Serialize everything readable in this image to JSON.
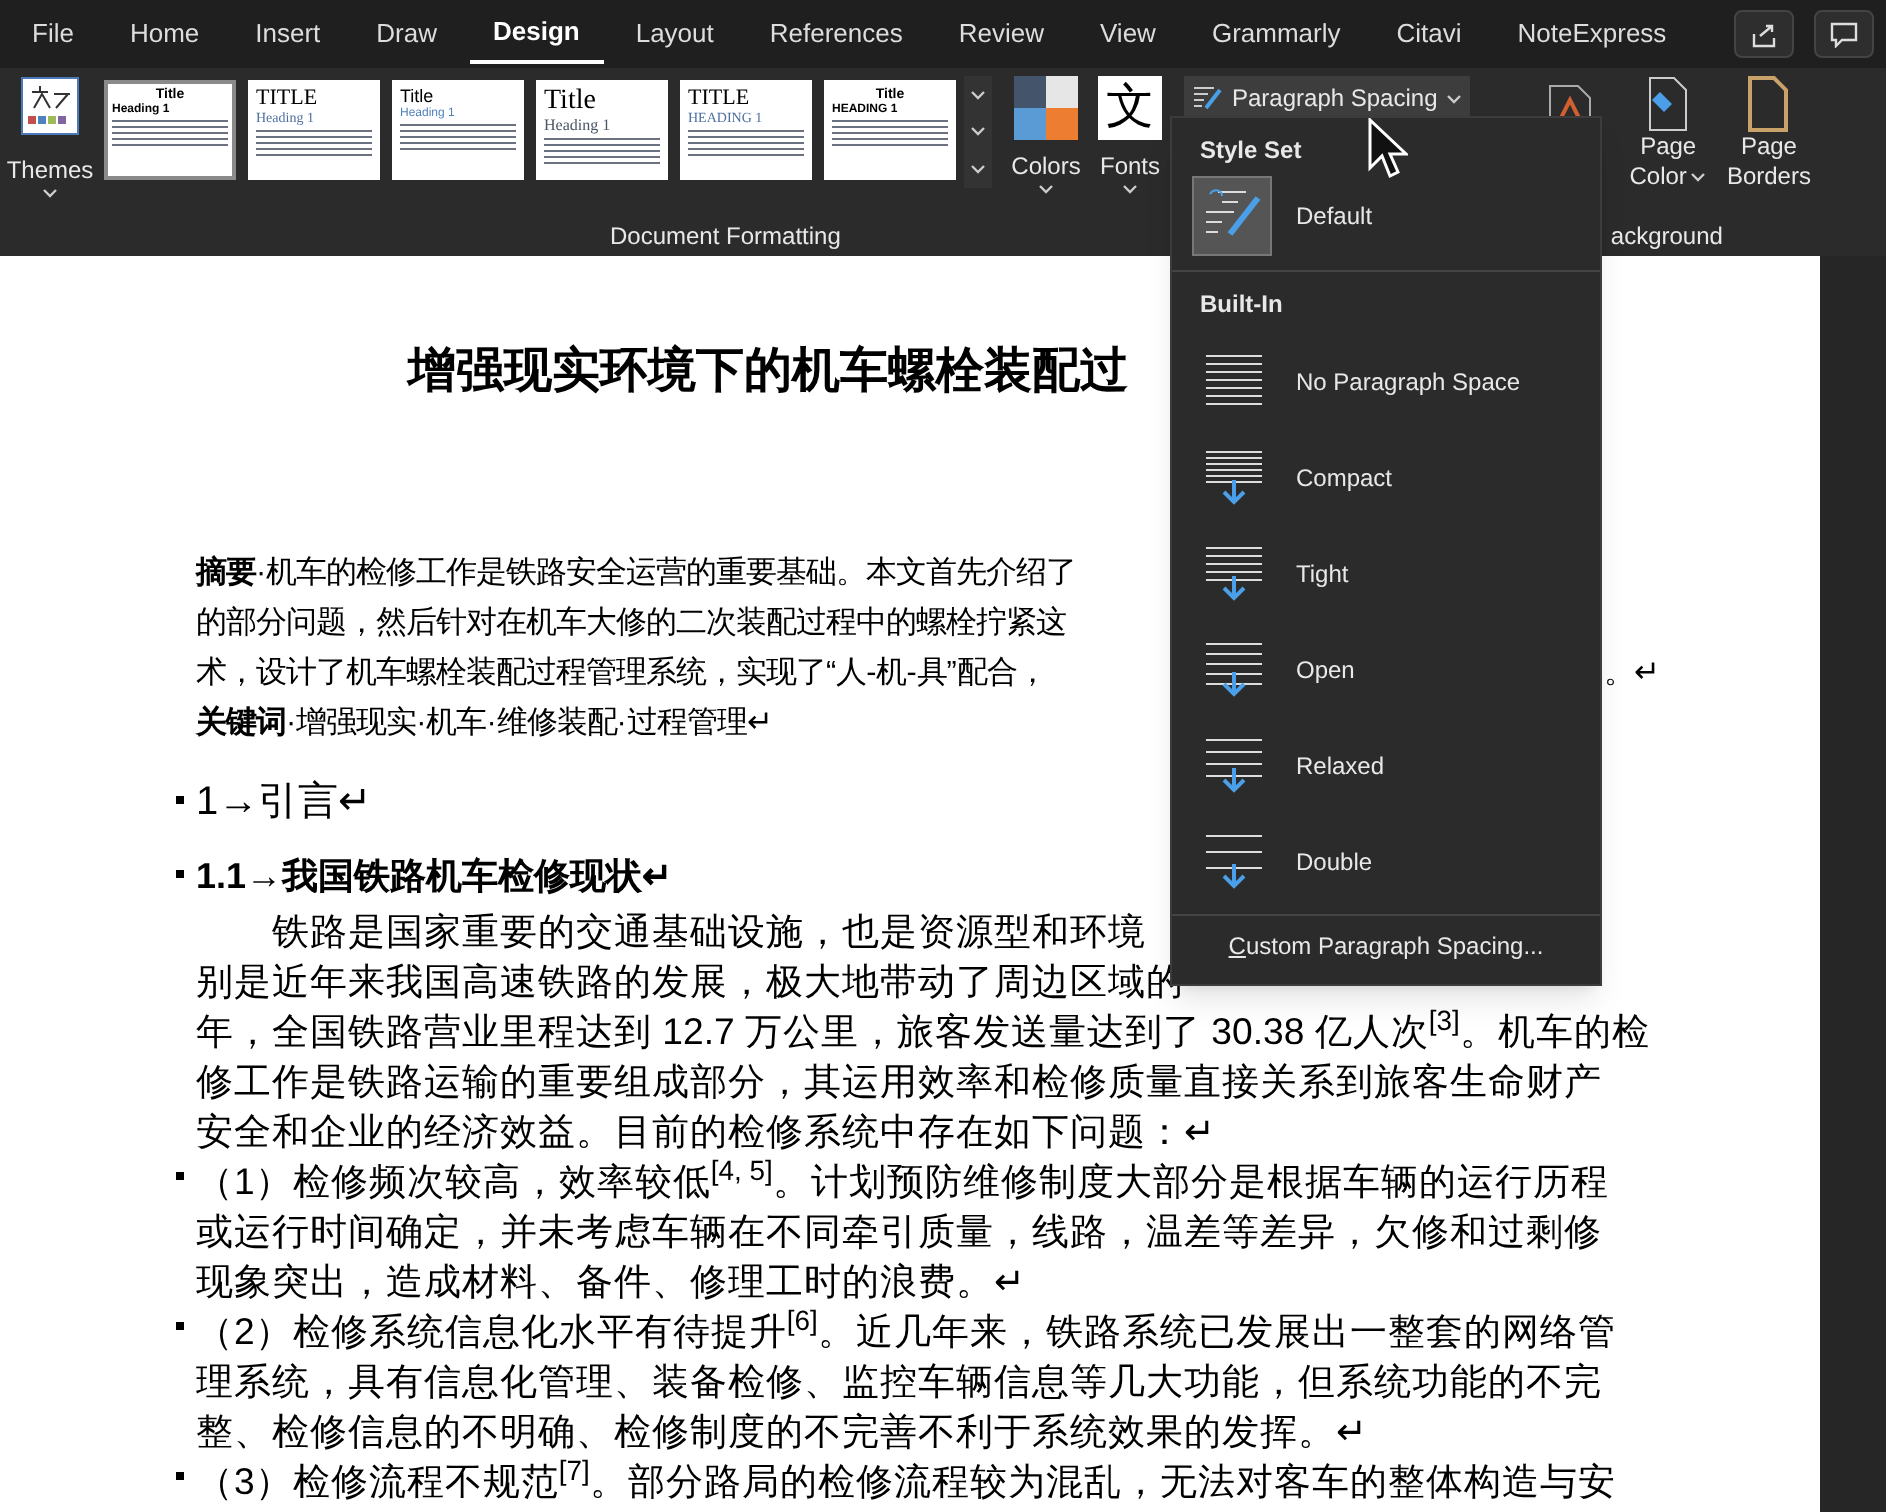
{
  "tabs": [
    {
      "label": "File",
      "selected": false
    },
    {
      "label": "Home",
      "selected": false
    },
    {
      "label": "Insert",
      "selected": false
    },
    {
      "label": "Draw",
      "selected": false
    },
    {
      "label": "Design",
      "selected": true
    },
    {
      "label": "Layout",
      "selected": false
    },
    {
      "label": "References",
      "selected": false
    },
    {
      "label": "Review",
      "selected": false
    },
    {
      "label": "View",
      "selected": false
    },
    {
      "label": "Grammarly",
      "selected": false
    },
    {
      "label": "Citavi",
      "selected": false
    },
    {
      "label": "NoteExpress",
      "selected": false
    }
  ],
  "ribbon": {
    "themes_label": "Themes",
    "style_sets": [
      {
        "kind": "centered",
        "title": "Title",
        "heading": "Heading 1",
        "selected": true
      },
      {
        "kind": "serif",
        "title": "TITLE",
        "heading": "Heading 1",
        "selected": false
      },
      {
        "kind": "blue",
        "title": "Title",
        "heading": "Heading 1",
        "selected": false
      },
      {
        "kind": "large",
        "title": "Title",
        "heading": "Heading 1",
        "selected": false
      },
      {
        "kind": "serif",
        "title": "TITLE",
        "heading": "HEADING 1",
        "selected": false
      },
      {
        "kind": "centered",
        "title": "Title",
        "heading": "HEADING 1",
        "selected": false
      }
    ],
    "colors_label": "Colors",
    "fonts_label": "Fonts",
    "fonts_glyph": "文",
    "paragraph_spacing_label": "Paragraph Spacing",
    "page_color_label": [
      "Page",
      "Color"
    ],
    "page_borders_label": [
      "Page",
      "Borders"
    ],
    "group_document_formatting": "Document Formatting",
    "group_background": "ackground"
  },
  "menu": {
    "style_set_header": "Style Set",
    "default_item": {
      "label": "Default",
      "selected": true
    },
    "builtin_header": "Built-In",
    "items": [
      {
        "kind": "none",
        "label": "No Paragraph Space"
      },
      {
        "kind": "compact",
        "label": "Compact"
      },
      {
        "kind": "tight",
        "label": "Tight"
      },
      {
        "kind": "open",
        "label": "Open"
      },
      {
        "kind": "relaxed",
        "label": "Relaxed"
      },
      {
        "kind": "double",
        "label": "Double"
      }
    ],
    "custom": "Custom Paragraph Spacing..."
  },
  "document": {
    "title": "增强现实环境下的机车螺栓装配过",
    "abstract_lines": [
      {
        "left": "**摘要**·机车的检修工作是铁路安全运营的重要基础。本文首先介绍了"
      },
      {
        "left": "的部分问题，然后针对在机车大修的二次装配过程中的螺栓拧紧这"
      },
      {
        "left": "术，设计了机车螺栓装配过程管理系统，实现了“人-机-具”配合，",
        "right": "。↵"
      },
      {
        "left": "**关键词**·增强现实·机车·维修装配·过程管理↵"
      }
    ],
    "heading_1": "1→引言↵",
    "heading_2": "1.1→我国铁路机车检修现状↵",
    "body_lines": [
      {
        "left": "铁路是国家重要的交通基础设施，也是资源型和环境",
        "indent": true
      },
      {
        "left": "别是近年来我国高速铁路的发展，极大地带动了周边区域的"
      },
      {
        "left": "年，全国铁路营业里程达到 12.7 万公里，旅客发送量达到了 30.38 亿人次$^{[3]}$。机车的检"
      },
      {
        "left": "修工作是铁路运输的重要组成部分，其运用效率和检修质量直接关系到旅客生命财产"
      },
      {
        "left": "安全和企业的经济效益。目前的检修系统中存在如下问题：↵"
      },
      {
        "left": "（1）检修频次较高，效率较低$^{[4, 5]}$。计划预防维修制度大部分是根据车辆的运行历程",
        "bullet": true
      },
      {
        "left": "或运行时间确定，并未考虑车辆在不同牵引质量，线路，温差等差异，欠修和过剩修"
      },
      {
        "left": "现象突出，造成材料、备件、修理工时的浪费。↵"
      },
      {
        "left": "（2）检修系统信息化水平有待提升$^{[6]}$。近几年来，铁路系统已发展出一整套的网络管",
        "bullet": true
      },
      {
        "left": "理系统，具有信息化管理、装备检修、监控车辆信息等几大功能，但系统功能的不完"
      },
      {
        "left": "整、检修信息的不明确、检修制度的不完善不利于系统效果的发挥。↵"
      },
      {
        "left": "（3）检修流程不规范$^{[7]}$。部分路局的检修流程较为混乱，无法对客车的整体构造与安",
        "bullet": true
      }
    ]
  }
}
